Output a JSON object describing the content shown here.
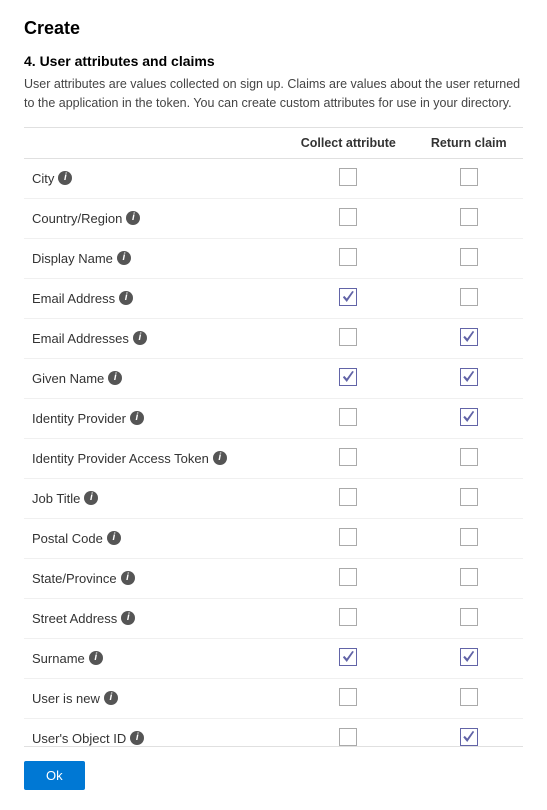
{
  "page": {
    "title": "Create",
    "section_number": "4. User attributes and claims",
    "description": "User attributes are values collected on sign up. Claims are values about the user returned to the application in the token. You can create custom attributes for use in your directory.",
    "col_collect": "Collect attribute",
    "col_return": "Return claim",
    "ok_label": "Ok"
  },
  "rows": [
    {
      "label": "City",
      "collect": false,
      "return": false
    },
    {
      "label": "Country/Region",
      "collect": false,
      "return": false
    },
    {
      "label": "Display Name",
      "collect": false,
      "return": false
    },
    {
      "label": "Email Address",
      "collect": true,
      "return": false
    },
    {
      "label": "Email Addresses",
      "collect": false,
      "return": true
    },
    {
      "label": "Given Name",
      "collect": true,
      "return": true
    },
    {
      "label": "Identity Provider",
      "collect": false,
      "return": true
    },
    {
      "label": "Identity Provider Access Token",
      "collect": false,
      "return": false
    },
    {
      "label": "Job Title",
      "collect": false,
      "return": false
    },
    {
      "label": "Postal Code",
      "collect": false,
      "return": false
    },
    {
      "label": "State/Province",
      "collect": false,
      "return": false
    },
    {
      "label": "Street Address",
      "collect": false,
      "return": false
    },
    {
      "label": "Surname",
      "collect": true,
      "return": true
    },
    {
      "label": "User is new",
      "collect": false,
      "return": false
    },
    {
      "label": "User's Object ID",
      "collect": false,
      "return": true
    }
  ]
}
